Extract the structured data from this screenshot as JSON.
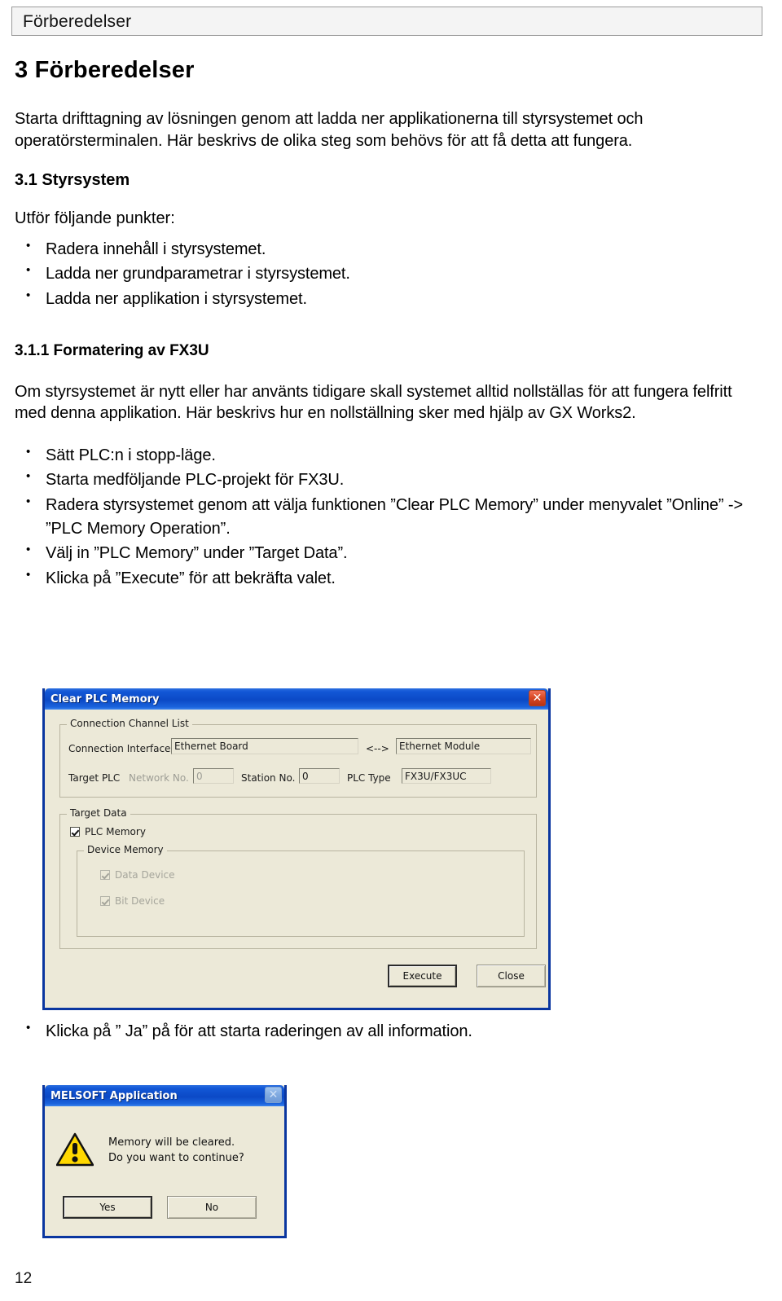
{
  "header": {
    "running_head": "Förberedelser"
  },
  "document": {
    "chapter_title": "3 Förberedelser",
    "intro": "Starta drifttagning av lösningen genom att ladda ner applikationerna till styrsystemet och operatörsterminalen. Här beskrivs de olika steg som behövs för att få detta att fungera.",
    "section_title": "3.1 Styrsystem",
    "section_lead": "Utför följande punkter:",
    "section_bullets": [
      "Radera innehåll i styrsystemet.",
      "Ladda ner grundparametrar i styrsystemet.",
      "Ladda ner applikation i styrsystemet."
    ],
    "subsection_title": "3.1.1 Formatering av FX3U",
    "subsection_para": "Om styrsystemet är nytt eller har använts tidigare skall systemet alltid nollställas för att fungera felfritt med denna applikation. Här beskrivs hur en nollställning sker med hjälp av GX Works2.",
    "subsection_bullets": [
      "Sätt PLC:n i stopp-läge.",
      "Starta medföljande PLC-projekt för FX3U.",
      "Radera styrsystemet genom att välja funktionen ”Clear PLC Memory” under menyvalet ”Online” -> ”PLC Memory Operation”.",
      "Välj in ”PLC Memory” under ”Target Data”.",
      "Klicka på ”Execute” för att bekräfta valet."
    ],
    "after_dialog_bullets": [
      "Klicka på ” Ja” på för att starta raderingen av all information."
    ],
    "page_number": "12"
  },
  "clear_plc_dialog": {
    "title": "Clear PLC Memory",
    "close_icon": "close-icon",
    "connection_group_label": "Connection Channel List",
    "connection_interface_label": "Connection Interface",
    "connection_interface_value": "Ethernet Board",
    "connection_arrow": "<-->",
    "connection_target_value": "Ethernet Module",
    "target_plc_label": "Target PLC",
    "network_no_label": "Network No.",
    "network_no_value": "0",
    "station_no_label": "Station No.",
    "station_no_value": "0",
    "plc_type_label": "PLC Type",
    "plc_type_value": "FX3U/FX3UC",
    "target_data_group_label": "Target Data",
    "plc_memory_checkbox_label": "PLC Memory",
    "device_memory_group_label": "Device Memory",
    "data_device_checkbox_label": "Data Device",
    "bit_device_checkbox_label": "Bit Device",
    "execute_button": "Execute",
    "close_button": "Close"
  },
  "melsoft_dialog": {
    "title": "MELSOFT Application",
    "close_icon": "close-icon",
    "warning_icon": "warning-triangle-icon",
    "message": "Memory will be cleared.\nDo you want to continue?",
    "yes_button": "Yes",
    "no_button": "No"
  },
  "colors": {
    "title_bar_blue": "#0b49c6",
    "dialog_face": "#ece9d8",
    "close_red": "#d94a26",
    "warning_yellow": "#ffd800"
  }
}
